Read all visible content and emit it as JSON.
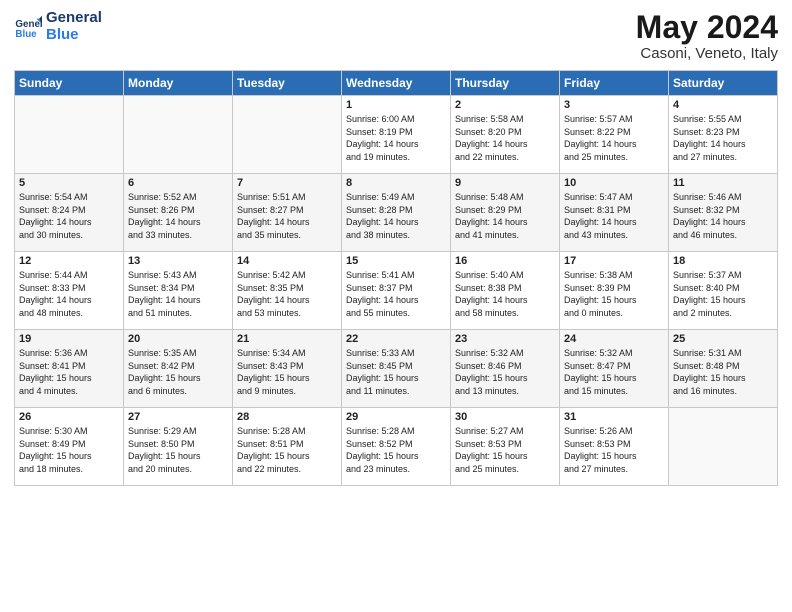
{
  "header": {
    "logo_line1": "General",
    "logo_line2": "Blue",
    "month_year": "May 2024",
    "location": "Casoni, Veneto, Italy"
  },
  "days_of_week": [
    "Sunday",
    "Monday",
    "Tuesday",
    "Wednesday",
    "Thursday",
    "Friday",
    "Saturday"
  ],
  "weeks": [
    [
      {
        "day": "",
        "info": ""
      },
      {
        "day": "",
        "info": ""
      },
      {
        "day": "",
        "info": ""
      },
      {
        "day": "1",
        "info": "Sunrise: 6:00 AM\nSunset: 8:19 PM\nDaylight: 14 hours\nand 19 minutes."
      },
      {
        "day": "2",
        "info": "Sunrise: 5:58 AM\nSunset: 8:20 PM\nDaylight: 14 hours\nand 22 minutes."
      },
      {
        "day": "3",
        "info": "Sunrise: 5:57 AM\nSunset: 8:22 PM\nDaylight: 14 hours\nand 25 minutes."
      },
      {
        "day": "4",
        "info": "Sunrise: 5:55 AM\nSunset: 8:23 PM\nDaylight: 14 hours\nand 27 minutes."
      }
    ],
    [
      {
        "day": "5",
        "info": "Sunrise: 5:54 AM\nSunset: 8:24 PM\nDaylight: 14 hours\nand 30 minutes."
      },
      {
        "day": "6",
        "info": "Sunrise: 5:52 AM\nSunset: 8:26 PM\nDaylight: 14 hours\nand 33 minutes."
      },
      {
        "day": "7",
        "info": "Sunrise: 5:51 AM\nSunset: 8:27 PM\nDaylight: 14 hours\nand 35 minutes."
      },
      {
        "day": "8",
        "info": "Sunrise: 5:49 AM\nSunset: 8:28 PM\nDaylight: 14 hours\nand 38 minutes."
      },
      {
        "day": "9",
        "info": "Sunrise: 5:48 AM\nSunset: 8:29 PM\nDaylight: 14 hours\nand 41 minutes."
      },
      {
        "day": "10",
        "info": "Sunrise: 5:47 AM\nSunset: 8:31 PM\nDaylight: 14 hours\nand 43 minutes."
      },
      {
        "day": "11",
        "info": "Sunrise: 5:46 AM\nSunset: 8:32 PM\nDaylight: 14 hours\nand 46 minutes."
      }
    ],
    [
      {
        "day": "12",
        "info": "Sunrise: 5:44 AM\nSunset: 8:33 PM\nDaylight: 14 hours\nand 48 minutes."
      },
      {
        "day": "13",
        "info": "Sunrise: 5:43 AM\nSunset: 8:34 PM\nDaylight: 14 hours\nand 51 minutes."
      },
      {
        "day": "14",
        "info": "Sunrise: 5:42 AM\nSunset: 8:35 PM\nDaylight: 14 hours\nand 53 minutes."
      },
      {
        "day": "15",
        "info": "Sunrise: 5:41 AM\nSunset: 8:37 PM\nDaylight: 14 hours\nand 55 minutes."
      },
      {
        "day": "16",
        "info": "Sunrise: 5:40 AM\nSunset: 8:38 PM\nDaylight: 14 hours\nand 58 minutes."
      },
      {
        "day": "17",
        "info": "Sunrise: 5:38 AM\nSunset: 8:39 PM\nDaylight: 15 hours\nand 0 minutes."
      },
      {
        "day": "18",
        "info": "Sunrise: 5:37 AM\nSunset: 8:40 PM\nDaylight: 15 hours\nand 2 minutes."
      }
    ],
    [
      {
        "day": "19",
        "info": "Sunrise: 5:36 AM\nSunset: 8:41 PM\nDaylight: 15 hours\nand 4 minutes."
      },
      {
        "day": "20",
        "info": "Sunrise: 5:35 AM\nSunset: 8:42 PM\nDaylight: 15 hours\nand 6 minutes."
      },
      {
        "day": "21",
        "info": "Sunrise: 5:34 AM\nSunset: 8:43 PM\nDaylight: 15 hours\nand 9 minutes."
      },
      {
        "day": "22",
        "info": "Sunrise: 5:33 AM\nSunset: 8:45 PM\nDaylight: 15 hours\nand 11 minutes."
      },
      {
        "day": "23",
        "info": "Sunrise: 5:32 AM\nSunset: 8:46 PM\nDaylight: 15 hours\nand 13 minutes."
      },
      {
        "day": "24",
        "info": "Sunrise: 5:32 AM\nSunset: 8:47 PM\nDaylight: 15 hours\nand 15 minutes."
      },
      {
        "day": "25",
        "info": "Sunrise: 5:31 AM\nSunset: 8:48 PM\nDaylight: 15 hours\nand 16 minutes."
      }
    ],
    [
      {
        "day": "26",
        "info": "Sunrise: 5:30 AM\nSunset: 8:49 PM\nDaylight: 15 hours\nand 18 minutes."
      },
      {
        "day": "27",
        "info": "Sunrise: 5:29 AM\nSunset: 8:50 PM\nDaylight: 15 hours\nand 20 minutes."
      },
      {
        "day": "28",
        "info": "Sunrise: 5:28 AM\nSunset: 8:51 PM\nDaylight: 15 hours\nand 22 minutes."
      },
      {
        "day": "29",
        "info": "Sunrise: 5:28 AM\nSunset: 8:52 PM\nDaylight: 15 hours\nand 23 minutes."
      },
      {
        "day": "30",
        "info": "Sunrise: 5:27 AM\nSunset: 8:53 PM\nDaylight: 15 hours\nand 25 minutes."
      },
      {
        "day": "31",
        "info": "Sunrise: 5:26 AM\nSunset: 8:53 PM\nDaylight: 15 hours\nand 27 minutes."
      },
      {
        "day": "",
        "info": ""
      }
    ]
  ]
}
